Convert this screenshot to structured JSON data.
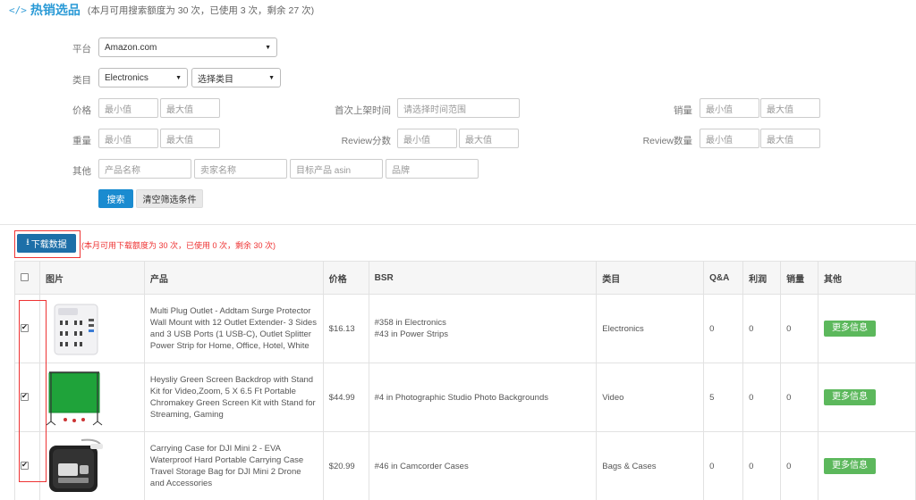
{
  "header": {
    "title": "热销选品",
    "quota_text": "(本月可用搜索额度为 30 次，已使用 3 次，剩余 27 次)"
  },
  "filters": {
    "platform_label": "平台",
    "platform_value": "Amazon.com",
    "category_label": "类目",
    "category_value": "Electronics",
    "category_sub_value": "选择类目",
    "price_label": "价格",
    "min_placeholder": "最小值",
    "max_placeholder": "最大值",
    "first_listed_label": "首次上架时间",
    "date_range_placeholder": "请选择时间范围",
    "sales_label": "销量",
    "weight_label": "重量",
    "review_score_label": "Review分数",
    "review_count_label": "Review数量",
    "other_label": "其他",
    "product_name_placeholder": "产品名称",
    "seller_name_placeholder": "卖家名称",
    "asin_placeholder": "目标产品 asin",
    "brand_placeholder": "品牌",
    "search_label": "搜索",
    "clear_label": "清空筛选条件"
  },
  "download": {
    "label": "下载数据",
    "quota_text": "(本月可用下载额度为 30 次，已使用 0 次，剩余 30 次)"
  },
  "table": {
    "columns": [
      "图片",
      "产品",
      "价格",
      "BSR",
      "类目",
      "Q&A",
      "利润",
      "销量",
      "其他"
    ],
    "rows": [
      {
        "checked": true,
        "product": "Multi Plug Outlet - Addtam Surge Protector Wall Mount with 12 Outlet Extender- 3 Sides and 3 USB Ports (1 USB-C), Outlet Splitter Power Strip for Home, Office, Hotel, White",
        "price": "$16.13",
        "bsr": [
          "#358 in Electronics",
          "#43 in Power Strips"
        ],
        "category": "Electronics",
        "qa": "0",
        "profit": "0",
        "sales": "0",
        "more": "更多信息"
      },
      {
        "checked": true,
        "product": "Heysliy Green Screen Backdrop with Stand Kit for Video,Zoom, 5 X 6.5 Ft Portable Chromakey Green Screen Kit with Stand for Streaming, Gaming",
        "price": "$44.99",
        "bsr": [
          "#4 in Photographic Studio Photo Backgrounds"
        ],
        "category": "Video",
        "qa": "5",
        "profit": "0",
        "sales": "0",
        "more": "更多信息"
      },
      {
        "checked": true,
        "product": "Carrying Case for DJI Mini 2 - EVA Waterproof Hard Portable Carrying Case Travel Storage Bag for DJI Mini 2 Drone and Accessories",
        "price": "$20.99",
        "bsr": [
          "#46 in Camcorder Cases"
        ],
        "category": "Bags & Cases",
        "qa": "0",
        "profit": "0",
        "sales": "0",
        "more": "更多信息"
      }
    ]
  },
  "colors": {
    "accent": "#2a9ad6",
    "primary_button": "#1a8bd0",
    "download_button": "#1d6fa8",
    "highlight_frame": "#e33333",
    "more_button": "#5cb85c"
  }
}
